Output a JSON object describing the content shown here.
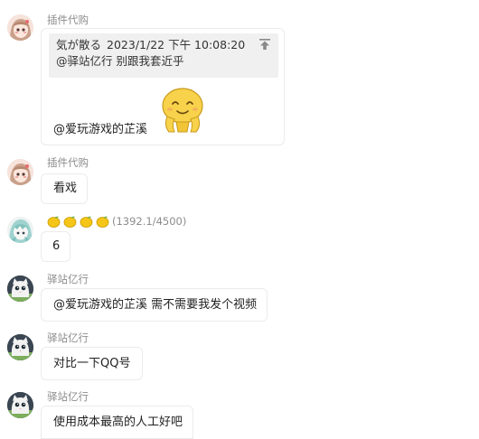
{
  "messages": [
    {
      "sender": "插件代购",
      "reply": {
        "author": "気が散る",
        "time": "2023/1/22 下午 10:08:20",
        "text": "@驿站亿行 别跟我套近乎"
      },
      "mention": "@爱玩游戏的芷溪",
      "sticker": "smiling-bean-sticker"
    },
    {
      "sender": "插件代购",
      "text": "看戏"
    },
    {
      "sender_badge": "(1392.1/4500)",
      "text": "6"
    },
    {
      "sender": "驿站亿行",
      "text": "@爱玩游戏的芷溪 需不需要我发个视频"
    },
    {
      "sender": "驿站亿行",
      "text": "对比一下QQ号"
    },
    {
      "sender": "驿站亿行",
      "text": "使用成本最高的人工好吧"
    }
  ],
  "colors": {
    "bubble_border": "#ebebeb",
    "quote_bg": "#f0f0f0",
    "sender_text": "#8c8c8c",
    "lemon": "#f5c518"
  }
}
